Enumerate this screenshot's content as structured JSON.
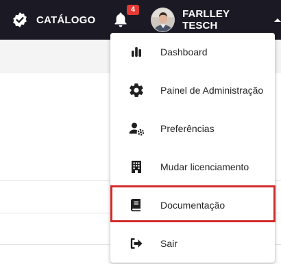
{
  "topbar": {
    "brand_icon": "verified-badge-icon",
    "brand_label": "CATÁLOGO",
    "notifications": {
      "icon": "bell-icon",
      "count": "4"
    },
    "user": {
      "avatar": "user-avatar-photo",
      "name": "FARLLEY TESCH",
      "caret_icon": "caret-up-icon"
    }
  },
  "menu": {
    "items": [
      {
        "label": "Dashboard",
        "icon": "bar-chart-icon"
      },
      {
        "label": "Painel de Administração",
        "icon": "gear-icon"
      },
      {
        "label": "Preferências",
        "icon": "user-settings-icon"
      },
      {
        "label": "Mudar licenciamento",
        "icon": "building-icon"
      },
      {
        "label": "Documentação",
        "icon": "book-icon",
        "highlighted": true
      },
      {
        "label": "Sair",
        "icon": "logout-icon"
      }
    ]
  },
  "colors": {
    "topbar_bg": "#1b1a24",
    "badge_bg": "#e53935",
    "highlight_border": "#d12a2a",
    "icon_color": "#1f1f1f"
  }
}
